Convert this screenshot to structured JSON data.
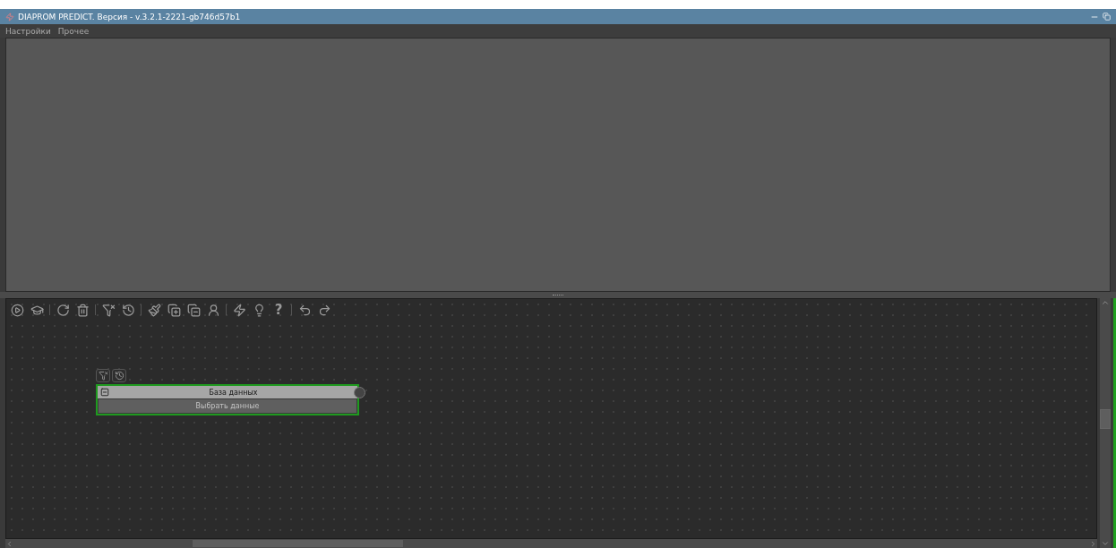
{
  "window": {
    "title": "DIAPROM PREDICT. Версия - v.3.2.1-2221-gb746d57b1"
  },
  "menu": [
    {
      "label": "Настройки"
    },
    {
      "label": "Прочее"
    }
  ],
  "toolbar": {
    "help_glyph": "?"
  },
  "nodes": [
    {
      "title": "База данных",
      "action": "Выбрать данные",
      "selected": true
    }
  ]
}
